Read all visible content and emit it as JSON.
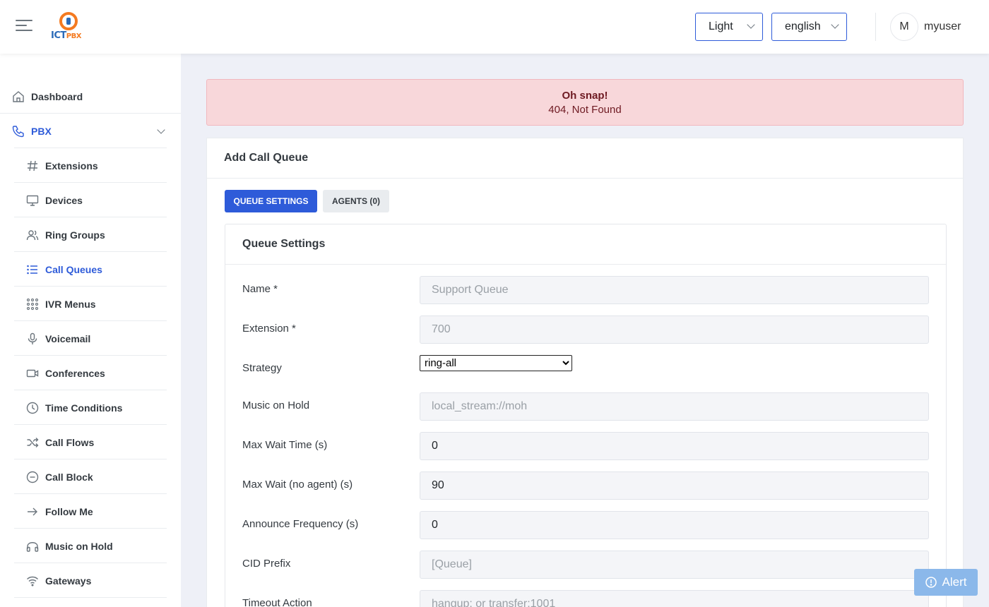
{
  "header": {
    "logo_text_1": "ICT",
    "logo_text_2": "PBX",
    "theme": "Light",
    "language": "english",
    "avatar_initial": "M",
    "username": "myuser"
  },
  "sidebar": {
    "dashboard": {
      "label": "Dashboard",
      "icon": "home-icon"
    },
    "pbx": {
      "label": "PBX",
      "icon": "phone-icon"
    },
    "items": [
      {
        "label": "Extensions",
        "icon": "hash-icon"
      },
      {
        "label": "Devices",
        "icon": "monitor-icon"
      },
      {
        "label": "Ring Groups",
        "icon": "users-icon"
      },
      {
        "label": "Call Queues",
        "icon": "list-icon",
        "active": true
      },
      {
        "label": "IVR Menus",
        "icon": "keypad-icon"
      },
      {
        "label": "Voicemail",
        "icon": "microphone-icon"
      },
      {
        "label": "Conferences",
        "icon": "video-icon"
      },
      {
        "label": "Time Conditions",
        "icon": "clock-icon"
      },
      {
        "label": "Call Flows",
        "icon": "shuffle-icon"
      },
      {
        "label": "Call Block",
        "icon": "minus-circle-icon"
      },
      {
        "label": "Follow Me",
        "icon": "arrow-right-icon"
      },
      {
        "label": "Music on Hold",
        "icon": "headphones-icon"
      },
      {
        "label": "Gateways",
        "icon": "wifi-icon"
      }
    ]
  },
  "alert": {
    "title": "Oh snap!",
    "message": "404, Not Found"
  },
  "card": {
    "title": "Add Call Queue",
    "tabs": [
      {
        "label": "QUEUE SETTINGS",
        "active": true
      },
      {
        "label": "AGENTS (0)",
        "active": false
      }
    ],
    "section_title": "Queue Settings",
    "fields": {
      "name": {
        "label": "Name *",
        "value": "",
        "placeholder": "Support Queue"
      },
      "extension": {
        "label": "Extension *",
        "value": "",
        "placeholder": "700"
      },
      "strategy": {
        "label": "Strategy",
        "value": "ring-all"
      },
      "moh": {
        "label": "Music on Hold",
        "value": "",
        "placeholder": "local_stream://moh"
      },
      "max_wait": {
        "label": "Max Wait Time (s)",
        "value": "0"
      },
      "max_wait_no_agent": {
        "label": "Max Wait (no agent) (s)",
        "value": "90"
      },
      "announce_freq": {
        "label": "Announce Frequency (s)",
        "value": "0"
      },
      "cid_prefix": {
        "label": "CID Prefix",
        "value": "",
        "placeholder": "[Queue]"
      },
      "timeout_action": {
        "label": "Timeout Action",
        "value": "",
        "placeholder": "hangup: or transfer:1001"
      }
    }
  },
  "floating": {
    "alert_label": "Alert"
  },
  "colors": {
    "accent": "#2e5bd9",
    "danger_bg": "#f8d7da",
    "alert_button": "#8bb8ea"
  }
}
